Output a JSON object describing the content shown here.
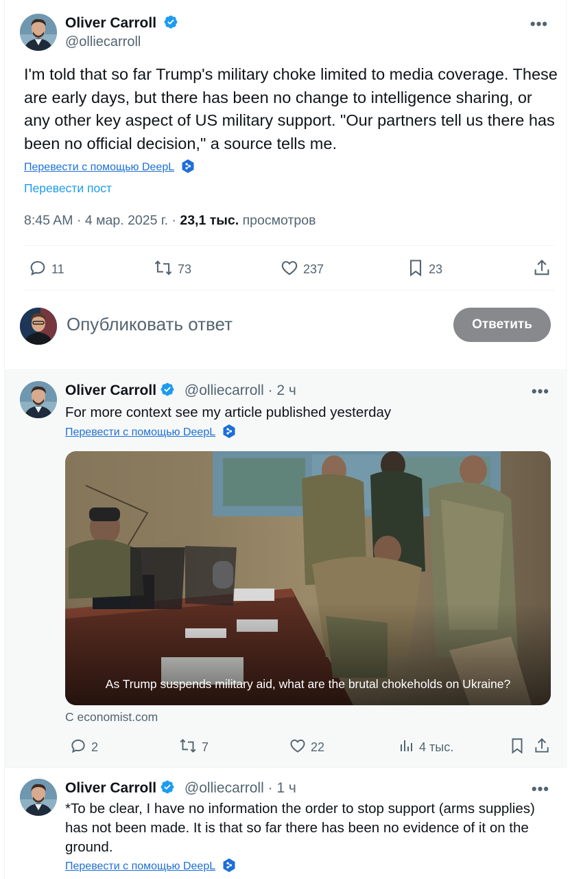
{
  "main_tweet": {
    "author_name": "Oliver Carroll",
    "author_handle": "@olliecarroll",
    "text": "I'm told that so far Trump's military choke limited to media coverage. These are early days, but there has been no change to intelligence sharing, or any other key aspect of US military support. \"Our partners tell us there has been no official decision,\" a source tells me.",
    "deepl_link": "Перевести с помощью DeepL",
    "translate_post": "Перевести пост",
    "timestamp": "8:45 AM · 4 мар. 2025 г. · ",
    "views_count": "23,1 тыс.",
    "views_label": " просмотров",
    "replies": "11",
    "reposts": "73",
    "likes": "237",
    "bookmarks": "23"
  },
  "reply_box": {
    "placeholder": "Опубликовать ответ",
    "button": "Ответить"
  },
  "thread": [
    {
      "author_name": "Oliver Carroll",
      "handle_time": "@olliecarroll · 2 ч",
      "text": "For more context see my article published yesterday",
      "deepl_link": "Перевести с помощью DeepL",
      "card_caption": "As Trump suspends military aid, what are the brutal chokeholds on Ukraine?",
      "card_source": "С economist.com",
      "replies": "2",
      "reposts": "7",
      "likes": "22",
      "views": "4 тыс."
    },
    {
      "author_name": "Oliver Carroll",
      "handle_time": "@olliecarroll · 1 ч",
      "text": "*To be clear, I have no information the order to stop support (arms supplies) has not been made. It is that so far there has been no evidence of it on the ground.",
      "deepl_link": "Перевести с помощью DeepL"
    }
  ],
  "icons": {
    "verified": "verified-badge-icon",
    "more": "more-options-icon",
    "reply": "reply-icon",
    "repost": "repost-icon",
    "like": "like-icon",
    "bookmark": "bookmark-icon",
    "share": "share-icon",
    "views": "views-icon",
    "deepl": "deepl-icon"
  },
  "colors": {
    "verified": "#1d9bf0",
    "link": "#1d9bf0",
    "secondary_text": "#536471",
    "reply_button": "#87898c",
    "thread_bg": "#f7f9f9"
  }
}
